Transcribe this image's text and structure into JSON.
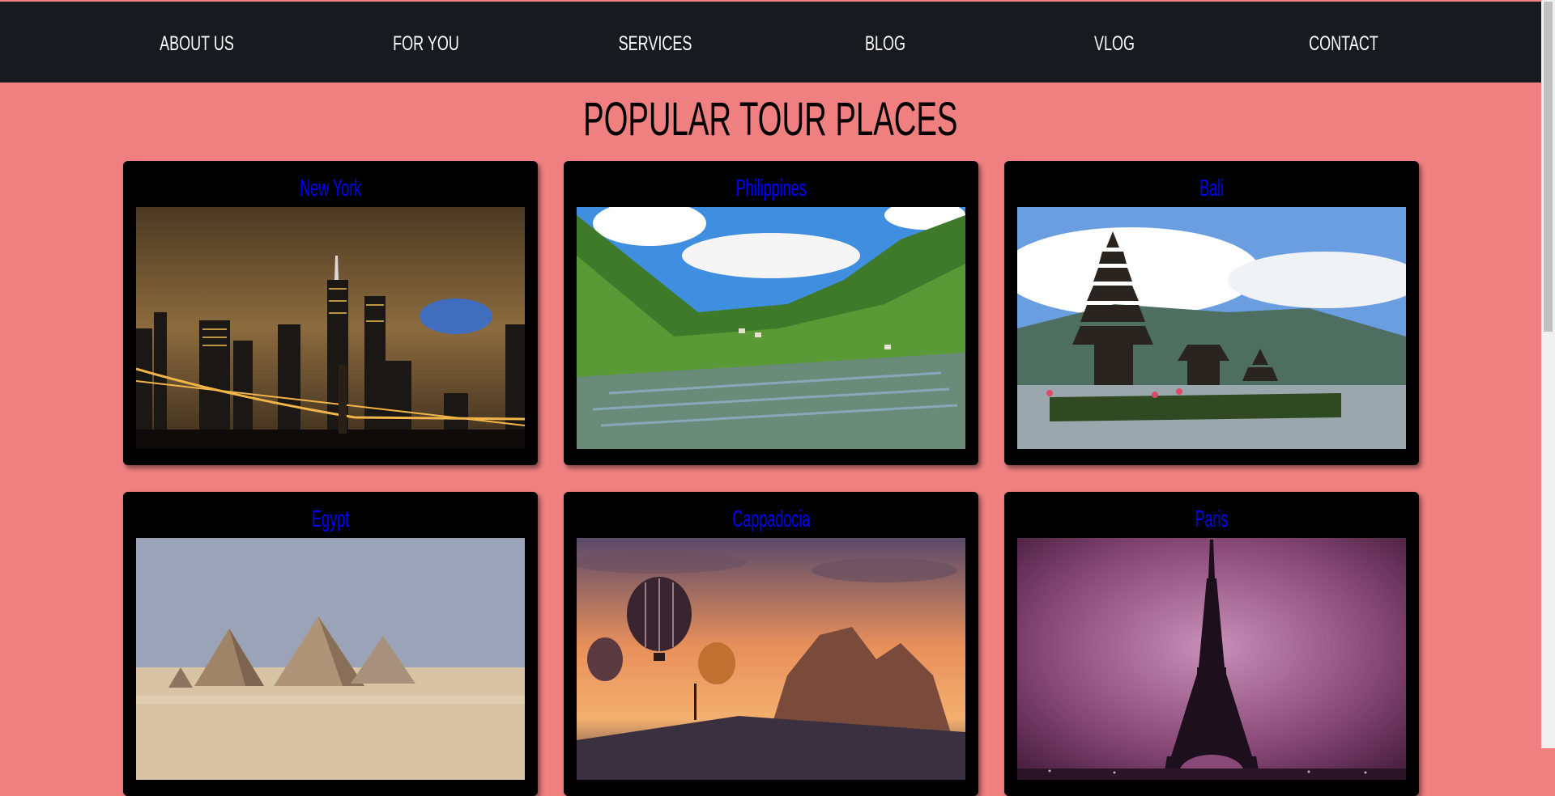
{
  "nav": {
    "items": [
      {
        "label": "ABOUT US"
      },
      {
        "label": "FOR YOU"
      },
      {
        "label": "SERVICES"
      },
      {
        "label": "BLOG"
      },
      {
        "label": "VLOG"
      },
      {
        "label": "CONTACT"
      }
    ]
  },
  "main": {
    "title": "POPULAR TOUR PLACES",
    "places": [
      {
        "name": "New York"
      },
      {
        "name": "Philippines"
      },
      {
        "name": "Bali"
      },
      {
        "name": "Egypt"
      },
      {
        "name": "Cappadocia"
      },
      {
        "name": "Paris"
      }
    ]
  },
  "colors": {
    "page_background": "#f08080",
    "navbar": "#171a1f",
    "card": "#000000",
    "card_title": "#0000ff",
    "nav_text": "#ffffff"
  }
}
